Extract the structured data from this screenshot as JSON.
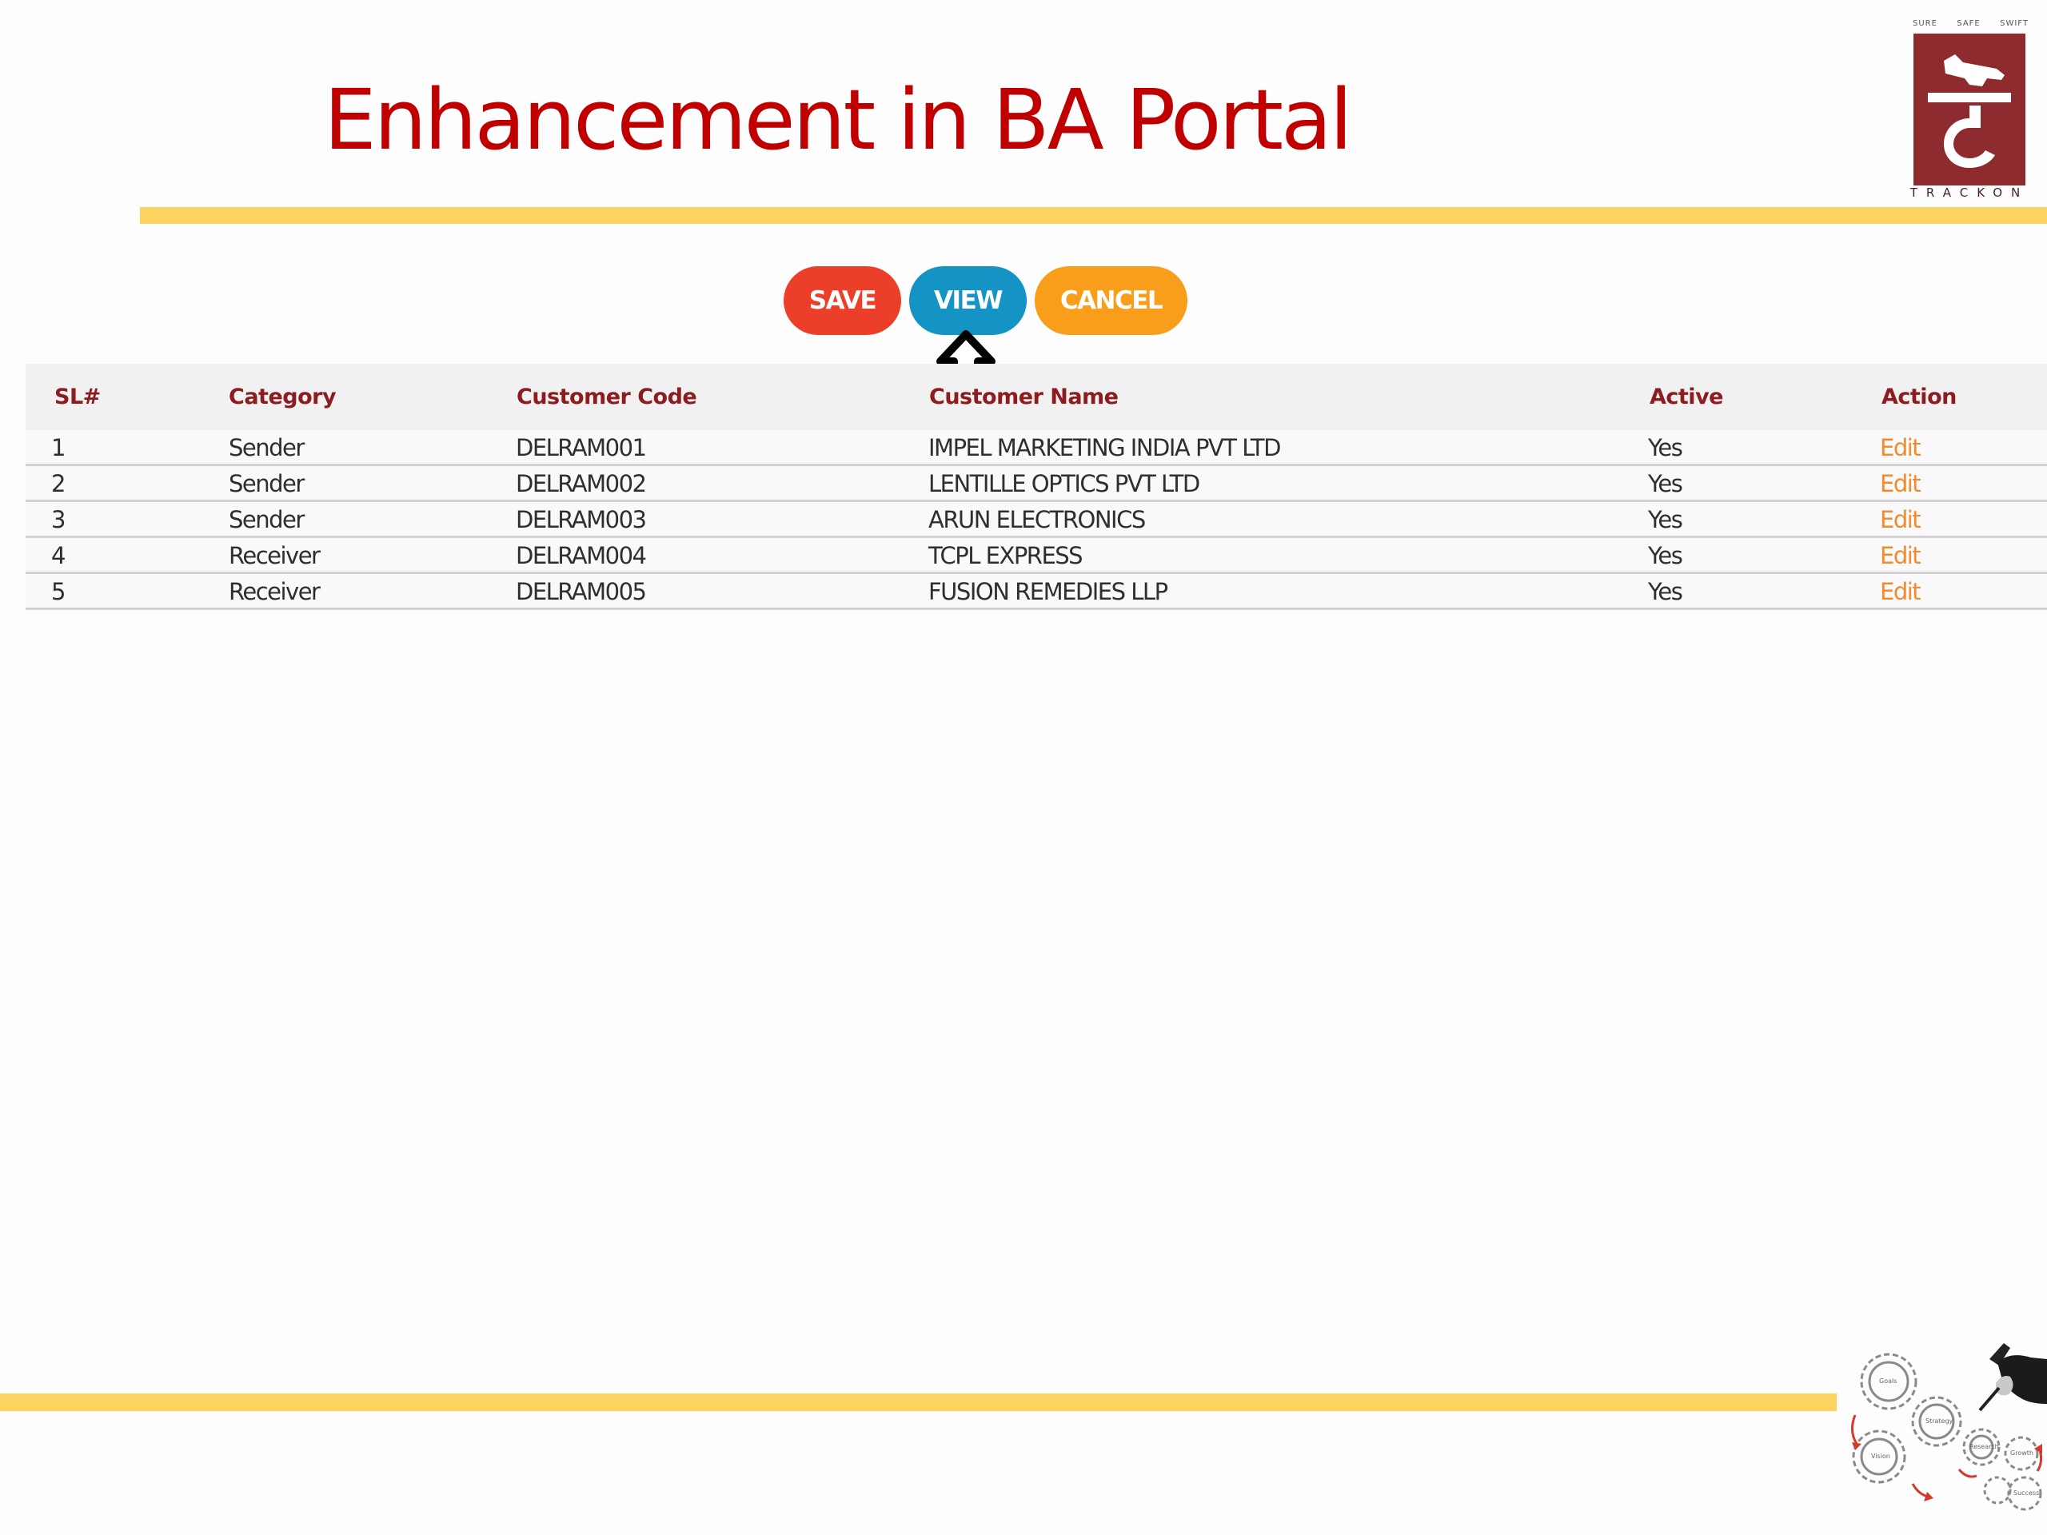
{
  "slide": {
    "title": "Enhancement in BA Portal"
  },
  "logo": {
    "brand": "TRACKON",
    "tags": [
      "SURE",
      "SAFE",
      "SWIFT"
    ]
  },
  "buttons": {
    "save_label": "SAVE",
    "view_label": "VIEW",
    "cancel_label": "CANCEL"
  },
  "table": {
    "headers": {
      "sl": "SL#",
      "category": "Category",
      "code": "Customer Code",
      "name": "Customer Name",
      "active": "Active",
      "action": "Action"
    },
    "rows": [
      {
        "sl": "1",
        "category": "Sender",
        "code": "DELRAM001",
        "name": "IMPEL MARKETING INDIA PVT LTD",
        "active": "Yes",
        "action": "Edit"
      },
      {
        "sl": "2",
        "category": "Sender",
        "code": "DELRAM002",
        "name": "LENTILLE OPTICS PVT LTD",
        "active": "Yes",
        "action": "Edit"
      },
      {
        "sl": "3",
        "category": "Sender",
        "code": "DELRAM003",
        "name": "ARUN ELECTRONICS",
        "active": "Yes",
        "action": "Edit"
      },
      {
        "sl": "4",
        "category": "Receiver",
        "code": "DELRAM004",
        "name": "TCPL EXPRESS",
        "active": "Yes",
        "action": "Edit"
      },
      {
        "sl": "5",
        "category": "Receiver",
        "code": "DELRAM005",
        "name": "FUSION REMEDIES LLP",
        "active": "Yes",
        "action": "Edit"
      }
    ]
  },
  "illustration": {
    "gear_labels": [
      "Goals",
      "Strategy",
      "Vision",
      "Research",
      "Growth",
      "Success"
    ]
  },
  "colors": {
    "title": "#c00000",
    "rule": "#fcd35f",
    "save": "#ec3f2a",
    "view": "#1493c5",
    "cancel": "#f89e1b",
    "header_text": "#8c1c20",
    "edit_link": "#f28a2e",
    "logo": "#8e2b2f"
  },
  "icons": {
    "cursor": "up-arrow-pointer-icon",
    "logo": "trackon-logo-icon",
    "illustration": "gears-hand-pen-icon"
  }
}
